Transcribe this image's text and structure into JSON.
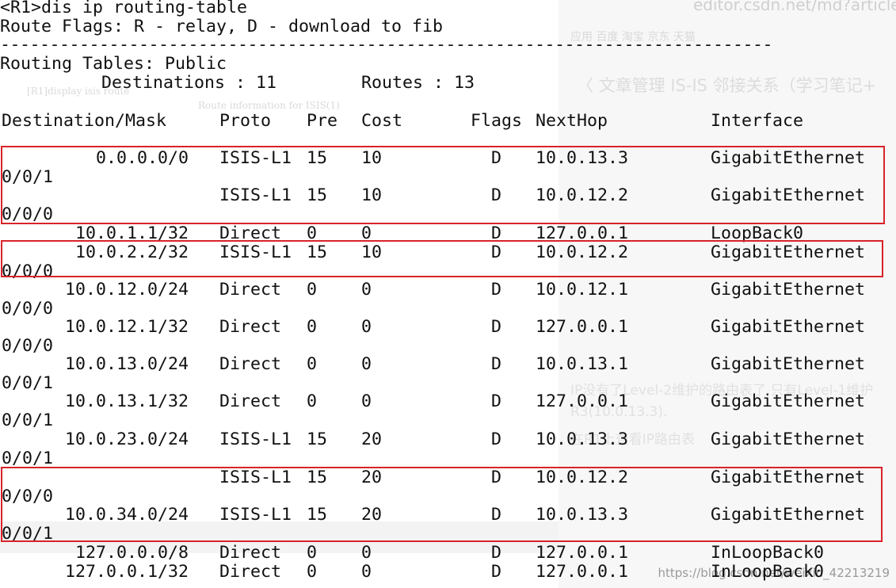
{
  "command": "<R1>dis ip routing-table",
  "flags_legend": "Route Flags: R - relay, D - download to fib",
  "separator": "------------------------------------------------------------------------------",
  "table_name": "Routing Tables: Public",
  "summary": {
    "destinations_label": "Destinations : 11",
    "routes_label": "Routes : 13"
  },
  "columns": [
    "Destination/Mask",
    "Proto",
    "Pre",
    "Cost",
    "Flags",
    "NextHop",
    "Interface"
  ],
  "routes": [
    {
      "dest": "0.0.0.0/0",
      "proto": "ISIS-L1",
      "pre": "15",
      "cost": "10",
      "flags": "D",
      "nexthop": "10.0.13.3",
      "iface": "GigabitEthernet",
      "iface_cont": "0/0/1"
    },
    {
      "dest": "",
      "proto": "ISIS-L1",
      "pre": "15",
      "cost": "10",
      "flags": "D",
      "nexthop": "10.0.12.2",
      "iface": "GigabitEthernet",
      "iface_cont": "0/0/0"
    },
    {
      "dest": "10.0.1.1/32",
      "proto": "Direct",
      "pre": "0",
      "cost": "0",
      "flags": "D",
      "nexthop": "127.0.0.1",
      "iface": "LoopBack0",
      "iface_cont": ""
    },
    {
      "dest": "10.0.2.2/32",
      "proto": "ISIS-L1",
      "pre": "15",
      "cost": "10",
      "flags": "D",
      "nexthop": "10.0.12.2",
      "iface": "GigabitEthernet",
      "iface_cont": "0/0/0"
    },
    {
      "dest": "10.0.12.0/24",
      "proto": "Direct",
      "pre": "0",
      "cost": "0",
      "flags": "D",
      "nexthop": "10.0.12.1",
      "iface": "GigabitEthernet",
      "iface_cont": "0/0/0"
    },
    {
      "dest": "10.0.12.1/32",
      "proto": "Direct",
      "pre": "0",
      "cost": "0",
      "flags": "D",
      "nexthop": "127.0.0.1",
      "iface": "GigabitEthernet",
      "iface_cont": "0/0/0"
    },
    {
      "dest": "10.0.13.0/24",
      "proto": "Direct",
      "pre": "0",
      "cost": "0",
      "flags": "D",
      "nexthop": "10.0.13.1",
      "iface": "GigabitEthernet",
      "iface_cont": "0/0/1"
    },
    {
      "dest": "10.0.13.1/32",
      "proto": "Direct",
      "pre": "0",
      "cost": "0",
      "flags": "D",
      "nexthop": "127.0.0.1",
      "iface": "GigabitEthernet",
      "iface_cont": "0/0/1"
    },
    {
      "dest": "10.0.23.0/24",
      "proto": "ISIS-L1",
      "pre": "15",
      "cost": "20",
      "flags": "D",
      "nexthop": "10.0.13.3",
      "iface": "GigabitEthernet",
      "iface_cont": "0/0/1"
    },
    {
      "dest": "",
      "proto": "ISIS-L1",
      "pre": "15",
      "cost": "20",
      "flags": "D",
      "nexthop": "10.0.12.2",
      "iface": "GigabitEthernet",
      "iface_cont": "0/0/0"
    },
    {
      "dest": "10.0.34.0/24",
      "proto": "ISIS-L1",
      "pre": "15",
      "cost": "20",
      "flags": "D",
      "nexthop": "10.0.13.3",
      "iface": "GigabitEthernet",
      "iface_cont": "0/0/1"
    },
    {
      "dest": "127.0.0.0/8",
      "proto": "Direct",
      "pre": "0",
      "cost": "0",
      "flags": "D",
      "nexthop": "127.0.0.1",
      "iface": "InLoopBack0",
      "iface_cont": ""
    },
    {
      "dest": "127.0.0.1/32",
      "proto": "Direct",
      "pre": "0",
      "cost": "0",
      "flags": "D",
      "nexthop": "127.0.0.1",
      "iface": "InLoopBack0",
      "iface_cont": ""
    }
  ],
  "background": {
    "url": "editor.csdn.net/md?articleId=",
    "toolbar": "应用   百度   淘宝   京东   天猫",
    "breadcrumb": "〈 文章管理   IS-IS 邻接关系（学习笔记+",
    "note1": "IP没有了Level-2维护的路由表了,只有Level-1维护",
    "note2": "R3(10.0.13.3).",
    "note3": "在R1上查看IP路由表",
    "src_title": "Route information for ISIS(1)",
    "src_cmd": "[R1]display isis route",
    "footer_url": "https://blog.csdn.net/weixin_42213219"
  },
  "highlight_color": "#d8232a"
}
